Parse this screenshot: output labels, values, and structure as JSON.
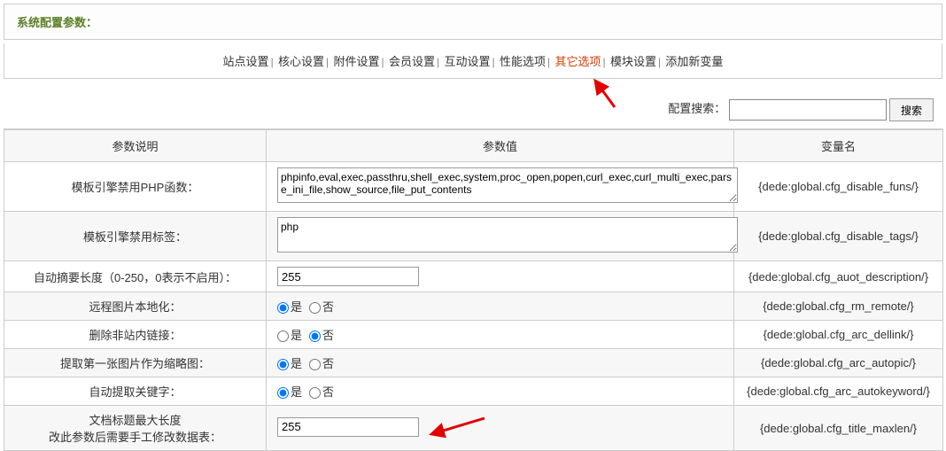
{
  "header": {
    "title": "系统配置参数："
  },
  "tabs": {
    "items": [
      {
        "label": "站点设置"
      },
      {
        "label": "核心设置"
      },
      {
        "label": "附件设置"
      },
      {
        "label": "会员设置"
      },
      {
        "label": "互动设置"
      },
      {
        "label": "性能选项"
      },
      {
        "label": "其它选项",
        "active": true
      },
      {
        "label": "模块设置"
      },
      {
        "label": "添加新变量"
      }
    ]
  },
  "search": {
    "label": "配置搜索：",
    "button": "搜索",
    "value": ""
  },
  "table": {
    "headers": {
      "desc": "参数说明",
      "value": "参数值",
      "var": "变量名"
    },
    "rows": [
      {
        "desc": "模板引擎禁用PHP函数：",
        "type": "textarea",
        "value": "phpinfo,eval,exec,passthru,shell_exec,system,proc_open,popen,curl_exec,curl_multi_exec,parse_ini_file,show_source,file_put_contents",
        "var": "{dede:global.cfg_disable_funs/}"
      },
      {
        "desc": "模板引擎禁用标签：",
        "type": "textarea",
        "value": "php",
        "var": "{dede:global.cfg_disable_tags/}"
      },
      {
        "desc": "自动摘要长度（0-250，0表示不启用）：",
        "type": "text",
        "value": "255",
        "var": "{dede:global.cfg_auot_description/}"
      },
      {
        "desc": "远程图片本地化：",
        "type": "radio",
        "opt_yes": "是",
        "opt_no": "否",
        "selected": "yes",
        "var": "{dede:global.cfg_rm_remote/}"
      },
      {
        "desc": "删除非站内链接：",
        "type": "radio",
        "opt_yes": "是",
        "opt_no": "否",
        "selected": "no",
        "var": "{dede:global.cfg_arc_dellink/}"
      },
      {
        "desc": "提取第一张图片作为缩略图：",
        "type": "radio",
        "opt_yes": "是",
        "opt_no": "否",
        "selected": "yes",
        "var": "{dede:global.cfg_arc_autopic/}"
      },
      {
        "desc": "自动提取关键字：",
        "type": "radio",
        "opt_yes": "是",
        "opt_no": "否",
        "selected": "yes",
        "var": "{dede:global.cfg_arc_autokeyword/}"
      },
      {
        "desc": "文档标题最大长度",
        "desc2": "改此参数后需要手工修改数据表：",
        "type": "text",
        "value": "255",
        "arrow": true,
        "var": "{dede:global.cfg_title_maxlen/}"
      }
    ]
  }
}
